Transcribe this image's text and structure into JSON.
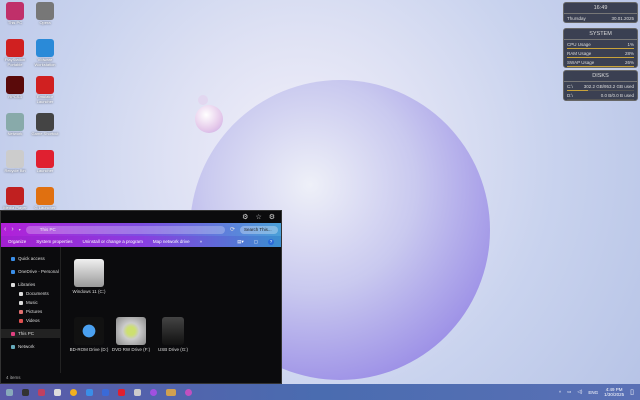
{
  "desktop": {
    "icons": [
      {
        "label": "This PC",
        "color": "#c0306a"
      },
      {
        "label": "Opera",
        "color": "#777"
      },
      {
        "label": "PlayStation Portable",
        "color": "#d02020"
      },
      {
        "label": "VMware Workstation",
        "color": "#2a8ad8"
      },
      {
        "label": "RPCS3",
        "color": "#5a0a0a"
      },
      {
        "label": "Emulator Launcher",
        "color": "#d02020"
      },
      {
        "label": "Network",
        "color": "#8aa"
      },
      {
        "label": "Game Shortcut",
        "color": "#444"
      },
      {
        "label": "Recycle Bin",
        "color": "#ccc"
      },
      {
        "label": "Launcher",
        "color": "#e02030"
      },
      {
        "label": "Media Player",
        "color": "#c02020"
      },
      {
        "label": "G Launcher",
        "color": "#e07010"
      }
    ]
  },
  "widgets": {
    "clock": {
      "time": "16:49",
      "day": "Thursday",
      "date": "30.01.2025"
    },
    "system": {
      "title": "SYSTEM",
      "rows": [
        {
          "label": "CPU Usage",
          "value": "1%"
        },
        {
          "label": "RAM Usage",
          "value": "28%"
        },
        {
          "label": "SWAP Usage",
          "value": "26%"
        }
      ]
    },
    "disks": {
      "title": "DISKS",
      "rows": [
        {
          "label": "C:\\",
          "value": "302.2 GB/953.2 GB used",
          "fill": 0.32
        },
        {
          "label": "D:\\",
          "value": "0.0 B/0.0 B used",
          "fill": 0
        }
      ]
    }
  },
  "explorer": {
    "title_icons": [
      "gear-icon",
      "star-icon",
      "settings-icon"
    ],
    "address": "This PC",
    "search_placeholder": "Search This...",
    "toolbar": [
      "Organize",
      "System properties",
      "Uninstall or change a program",
      "Map network drive"
    ],
    "nav": [
      {
        "label": "Quick access",
        "indent": false,
        "color": "#3a8ee8"
      },
      {
        "label": "OneDrive - Personal",
        "indent": false,
        "color": "#3a8ee8"
      },
      {
        "label": "Libraries",
        "indent": false,
        "color": "#ddd"
      },
      {
        "label": "Documents",
        "indent": true,
        "color": "#ddd"
      },
      {
        "label": "Music",
        "indent": true,
        "color": "#ddd"
      },
      {
        "label": "Pictures",
        "indent": true,
        "color": "#e07070"
      },
      {
        "label": "Videos",
        "indent": true,
        "color": "#e05050"
      },
      {
        "label": "This PC",
        "indent": false,
        "color": "#e04080",
        "selected": true
      },
      {
        "label": "Network",
        "indent": false,
        "color": "#6ab"
      }
    ],
    "drives": [
      {
        "label": "Windows 11 (C:)"
      },
      {
        "label": "BD-ROM Drive (D:)"
      },
      {
        "label": "DVD RW Drive (F:)"
      },
      {
        "label": "USB Drive (G:)"
      }
    ],
    "status": "4 items"
  },
  "taskbar": {
    "tray": {
      "lang": "ENG",
      "time": "4:49 PM",
      "date": "1/30/2025"
    }
  }
}
